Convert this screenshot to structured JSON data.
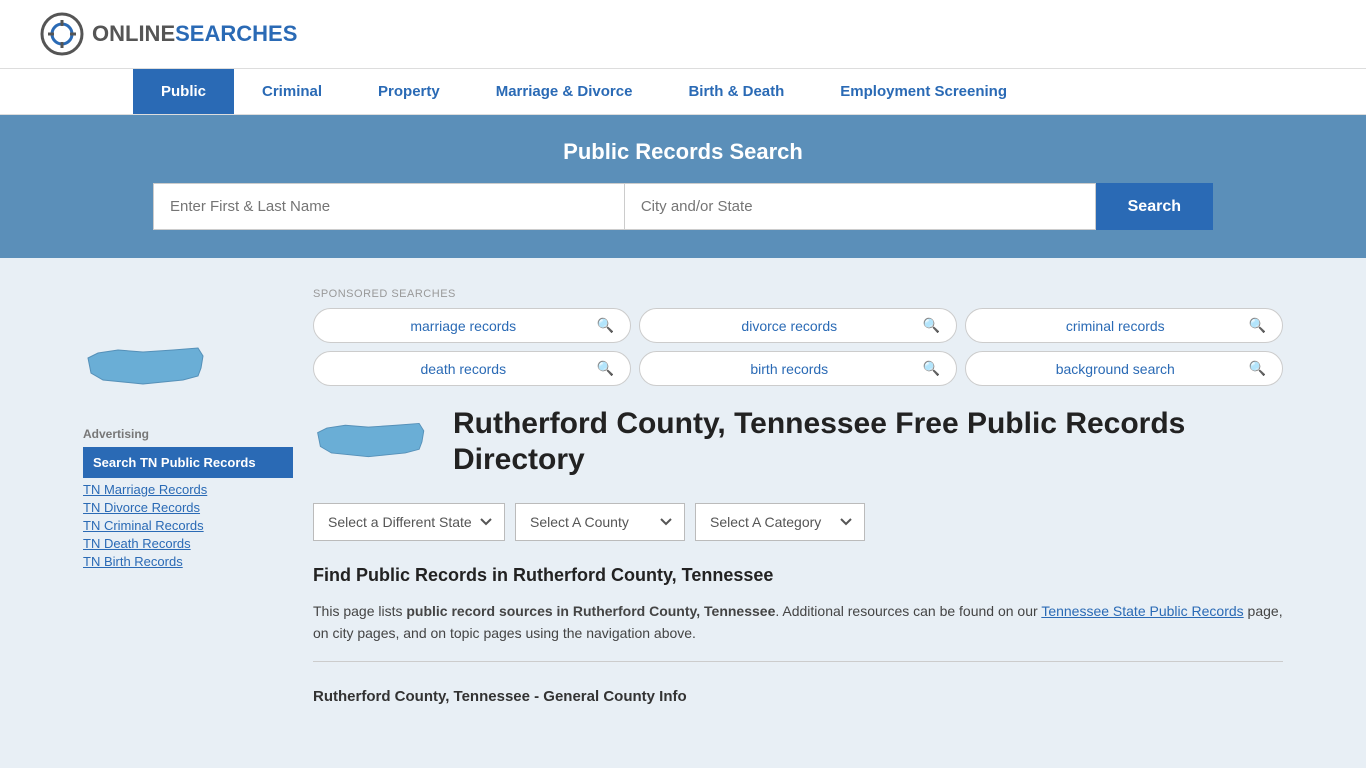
{
  "header": {
    "logo_online": "ONLINE",
    "logo_searches": "SEARCHES"
  },
  "nav": {
    "items": [
      {
        "label": "Public",
        "active": true
      },
      {
        "label": "Criminal",
        "active": false
      },
      {
        "label": "Property",
        "active": false
      },
      {
        "label": "Marriage & Divorce",
        "active": false
      },
      {
        "label": "Birth & Death",
        "active": false
      },
      {
        "label": "Employment Screening",
        "active": false
      }
    ]
  },
  "search_banner": {
    "title": "Public Records Search",
    "name_placeholder": "Enter First & Last Name",
    "location_placeholder": "City and/or State",
    "button_label": "Search"
  },
  "sponsored": {
    "label": "SPONSORED SEARCHES",
    "items": [
      {
        "text": "marriage records"
      },
      {
        "text": "divorce records"
      },
      {
        "text": "criminal records"
      },
      {
        "text": "death records"
      },
      {
        "text": "birth records"
      },
      {
        "text": "background search"
      }
    ]
  },
  "sidebar": {
    "ad_label": "Advertising",
    "ad_highlight": "Search TN Public Records",
    "links": [
      "TN Marriage Records",
      "TN Divorce Records",
      "TN Criminal Records",
      "TN Death Records",
      "TN Birth Records"
    ]
  },
  "content": {
    "page_title": "Rutherford County, Tennessee Free Public Records Directory",
    "dropdowns": {
      "state_label": "Select a Different State",
      "county_label": "Select A County",
      "category_label": "Select A Category"
    },
    "find_title": "Find Public Records in Rutherford County, Tennessee",
    "description_part1": "This page lists ",
    "description_bold1": "public record sources in Rutherford County, Tennessee",
    "description_part2": ". Additional resources can be found on our ",
    "description_link": "Tennessee State Public Records",
    "description_part3": " page, on city pages, and on topic pages using the navigation above.",
    "county_info_title": "Rutherford County, Tennessee - General County Info"
  }
}
